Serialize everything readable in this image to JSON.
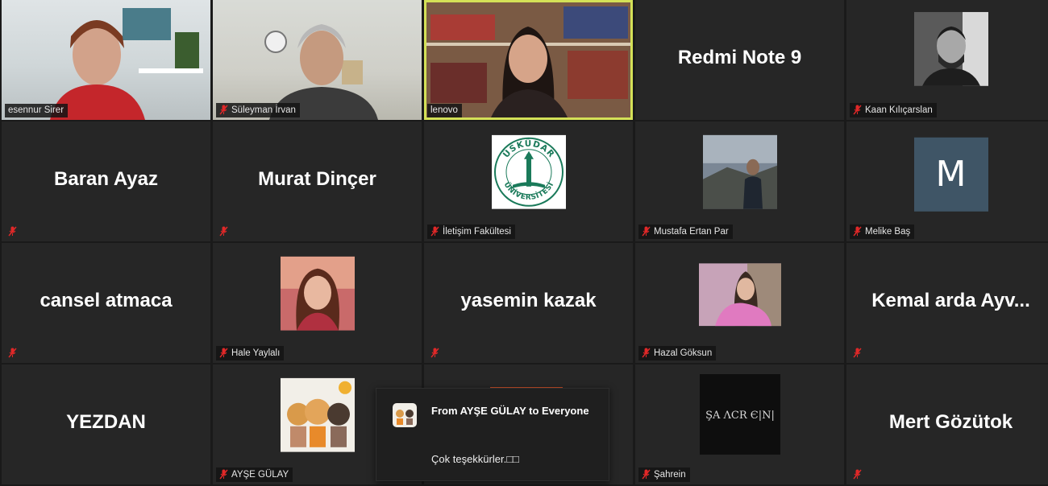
{
  "meeting": {
    "tiles": [
      {
        "name": "esennur Sirer",
        "type": "video"
      },
      {
        "name": "Süleyman İrvan",
        "type": "video"
      },
      {
        "name": "lenovo",
        "type": "video"
      },
      {
        "name": "Redmi Note 9",
        "type": "name"
      },
      {
        "name": "Kaan Kılıçarslan",
        "type": "photo"
      },
      {
        "name": "Baran Ayaz",
        "type": "name"
      },
      {
        "name": "Murat Dinçer",
        "type": "name"
      },
      {
        "name": "İletişim Fakültesi",
        "type": "logo",
        "logo_top": "ÜSKÜDAR",
        "logo_bottom": "ÜNİVERSİTESİ"
      },
      {
        "name": "Mustafa Ertan Par",
        "type": "photo"
      },
      {
        "name": "Melike Baş",
        "type": "letter",
        "letter": "M"
      },
      {
        "name": "cansel atmaca",
        "type": "name"
      },
      {
        "name": "Hale Yaylalı",
        "type": "photo"
      },
      {
        "name": "yasemin kazak",
        "type": "name"
      },
      {
        "name": "Hazal Göksun",
        "type": "photo"
      },
      {
        "name": "Kemal arda Ayv...",
        "type": "name"
      },
      {
        "name": "YEZDAN",
        "type": "name"
      },
      {
        "name": "AYŞE GÜLAY",
        "type": "photo"
      },
      {
        "name": "",
        "type": "blank"
      },
      {
        "name": "Şahrein",
        "type": "photo",
        "avatar_text": "ŞA ΛCR Є|Ν|"
      },
      {
        "name": "Mert Gözütok",
        "type": "name"
      }
    ]
  },
  "chat_notification": {
    "from": "From AYŞE GÜLAY to Everyone",
    "message": "Çok teşekkürler.□□"
  },
  "colors": {
    "active_speaker_border": "#d4e157",
    "mute_icon": "#e02828",
    "melike_avatar_bg": "#3f5566"
  }
}
